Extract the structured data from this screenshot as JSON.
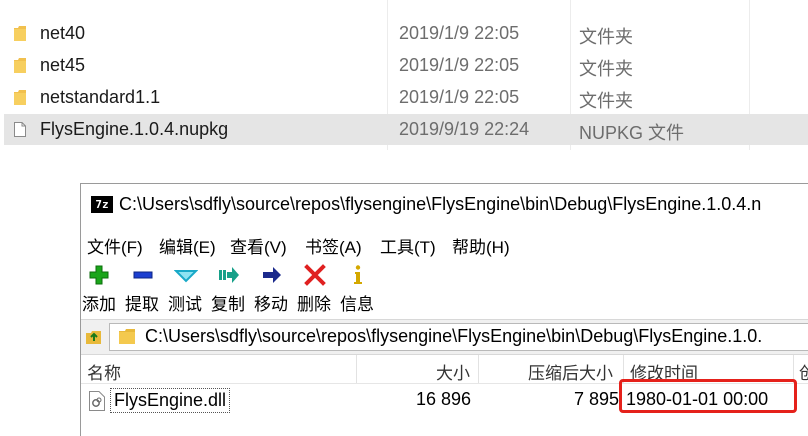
{
  "explorer": {
    "rows": [
      {
        "name": "net40",
        "date": "2019/1/9 22:05",
        "type": "文件夹",
        "icon": "folder-icon"
      },
      {
        "name": "net45",
        "date": "2019/1/9 22:05",
        "type": "文件夹",
        "icon": "folder-icon"
      },
      {
        "name": "netstandard1.1",
        "date": "2019/1/9 22:05",
        "type": "文件夹",
        "icon": "folder-icon"
      },
      {
        "name": "FlysEngine.1.0.4.nupkg",
        "date": "2019/9/19 22:24",
        "type": "NUPKG 文件",
        "icon": "file-icon"
      }
    ]
  },
  "zip": {
    "app_icon": "7z",
    "title": "C:\\Users\\sdfly\\source\\repos\\flysengine\\FlysEngine\\bin\\Debug\\FlysEngine.1.0.4.n",
    "menu": [
      "文件(F)",
      "编辑(E)",
      "查看(V)",
      "书签(A)",
      "工具(T)",
      "帮助(H)"
    ],
    "toolbar": [
      {
        "label": "添加",
        "icon": "add-icon",
        "color": "#1aa51a"
      },
      {
        "label": "提取",
        "icon": "extract-icon",
        "color": "#1c3fd0"
      },
      {
        "label": "测试",
        "icon": "test-icon",
        "color": "#19a9c8"
      },
      {
        "label": "复制",
        "icon": "copy-icon",
        "color": "#17a089"
      },
      {
        "label": "移动",
        "icon": "move-icon",
        "color": "#1b2a8c"
      },
      {
        "label": "删除",
        "icon": "delete-icon",
        "color": "#e02020"
      },
      {
        "label": "信息",
        "icon": "info-icon",
        "color": "#d4a800"
      }
    ],
    "path": "C:\\Users\\sdfly\\source\\repos\\flysengine\\FlysEngine\\bin\\Debug\\FlysEngine.1.0.",
    "columns": [
      "名称",
      "大小",
      "压缩后大小",
      "修改时间",
      "创"
    ],
    "files": [
      {
        "name": "FlysEngine.dll",
        "size": "16 896",
        "packed": "7 895",
        "modified": "1980-01-01 00:00"
      }
    ],
    "highlight_color": "#e5211b"
  }
}
